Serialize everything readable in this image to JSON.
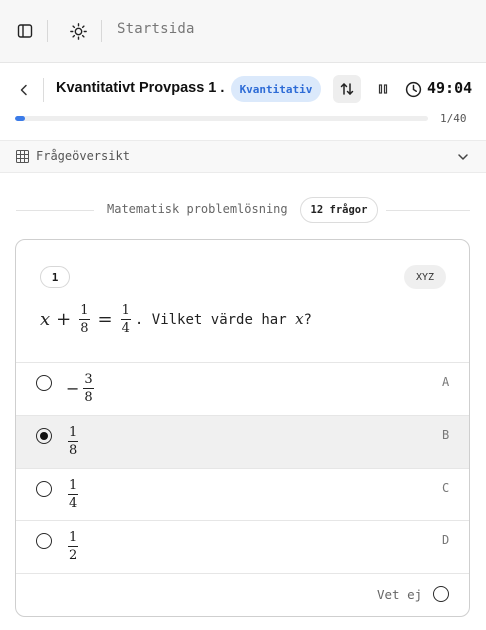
{
  "topbar": {
    "sidebar_icon": "sidebar-panel-icon",
    "theme_icon": "sun-icon",
    "breadcrumb": "Startsida"
  },
  "header": {
    "back_icon": "chevron-left-icon",
    "title": "Kvantitativt Provpass 1 ...",
    "badge": "Kvantitativ",
    "sort_icon": "arrows-up-down-icon",
    "pause_icon": "pause-icon",
    "clock_icon": "clock-icon",
    "timer": "49:04",
    "progress_fraction": 0.025,
    "progress_label": "1/40"
  },
  "overview": {
    "icon": "grid-icon",
    "label": "Frågeöversikt",
    "toggle_icon": "chevron-down-icon"
  },
  "section": {
    "title": "Matematisk problemlösning",
    "count": "12 frågor"
  },
  "question": {
    "number": "1",
    "code": "XYZ",
    "var": "x",
    "plus": "+",
    "f1_num": "1",
    "f1_den": "8",
    "equals": "=",
    "f2_num": "1",
    "f2_den": "4",
    "text": ". Vilket värde har",
    "var2": "x",
    "end": "?"
  },
  "options": [
    {
      "sign": "−",
      "num": "3",
      "den": "8",
      "letter": "A",
      "selected": false
    },
    {
      "sign": "",
      "num": "1",
      "den": "8",
      "letter": "B",
      "selected": true
    },
    {
      "sign": "",
      "num": "1",
      "den": "4",
      "letter": "C",
      "selected": false
    },
    {
      "sign": "",
      "num": "1",
      "den": "2",
      "letter": "D",
      "selected": false
    }
  ],
  "dont_know": {
    "label": "Vet ej"
  },
  "colors": {
    "accent": "#3b7be8",
    "badge_bg": "#dbe9fb",
    "badge_text": "#2d6bd6",
    "selected_row": "#f0f0f0"
  }
}
